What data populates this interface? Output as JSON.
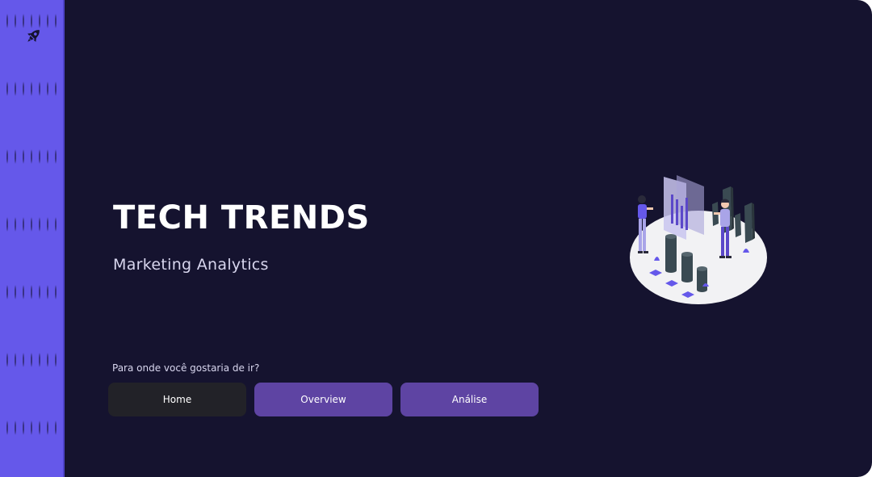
{
  "sidebar": {
    "logo_icon": "rocket-icon",
    "accent_color": "#6558ea"
  },
  "main": {
    "title": "TECH TRENDS",
    "subtitle": "Marketing Analytics",
    "prompt": "Para onde você gostaria de ir?",
    "background_color": "#15132f"
  },
  "nav": {
    "buttons": [
      {
        "label": "Home",
        "color": "#222228"
      },
      {
        "label": "Overview",
        "color": "#5e44a3"
      },
      {
        "label": "Análise",
        "color": "#5e44a3"
      }
    ]
  },
  "illustration": {
    "icon": "analytics-illustration"
  }
}
